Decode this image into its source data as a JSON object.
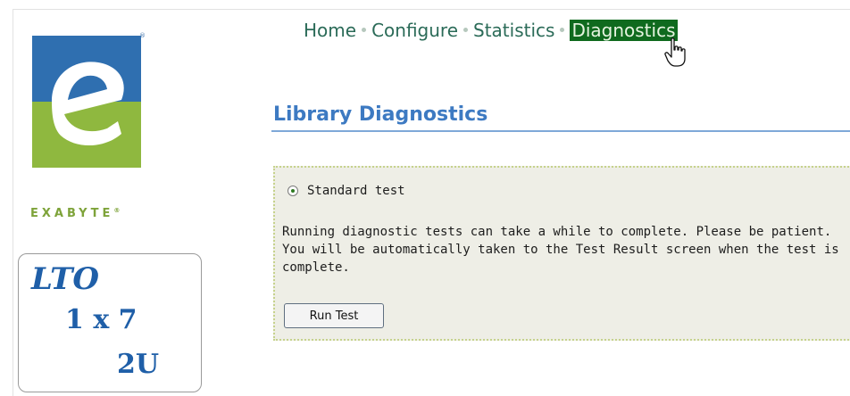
{
  "brand": {
    "wordmark": "EXABYTE",
    "trademark": "®",
    "icon": "exabyte-e-logo",
    "colors": {
      "blue": "#2f6fb0",
      "green": "#8fb83f"
    }
  },
  "model_box": {
    "line1": "LTO",
    "line2": "1 x 7",
    "line3": "2U"
  },
  "nav": {
    "items": [
      {
        "label": "Home"
      },
      {
        "label": "Configure"
      },
      {
        "label": "Statistics"
      },
      {
        "label": "Diagnostics",
        "active": true
      }
    ],
    "active_color": "#0f6a1e"
  },
  "cursor": {
    "icon": "hand-pointer-icon"
  },
  "heading": {
    "title": "Library Diagnostics"
  },
  "panel": {
    "radio_label": "Standard test",
    "radio_selected": true,
    "description": "Running diagnostic tests can take a while to complete. Please be patient. You will be automatically taken to the Test Result screen when the test is complete.",
    "button_label": "Run Test"
  }
}
